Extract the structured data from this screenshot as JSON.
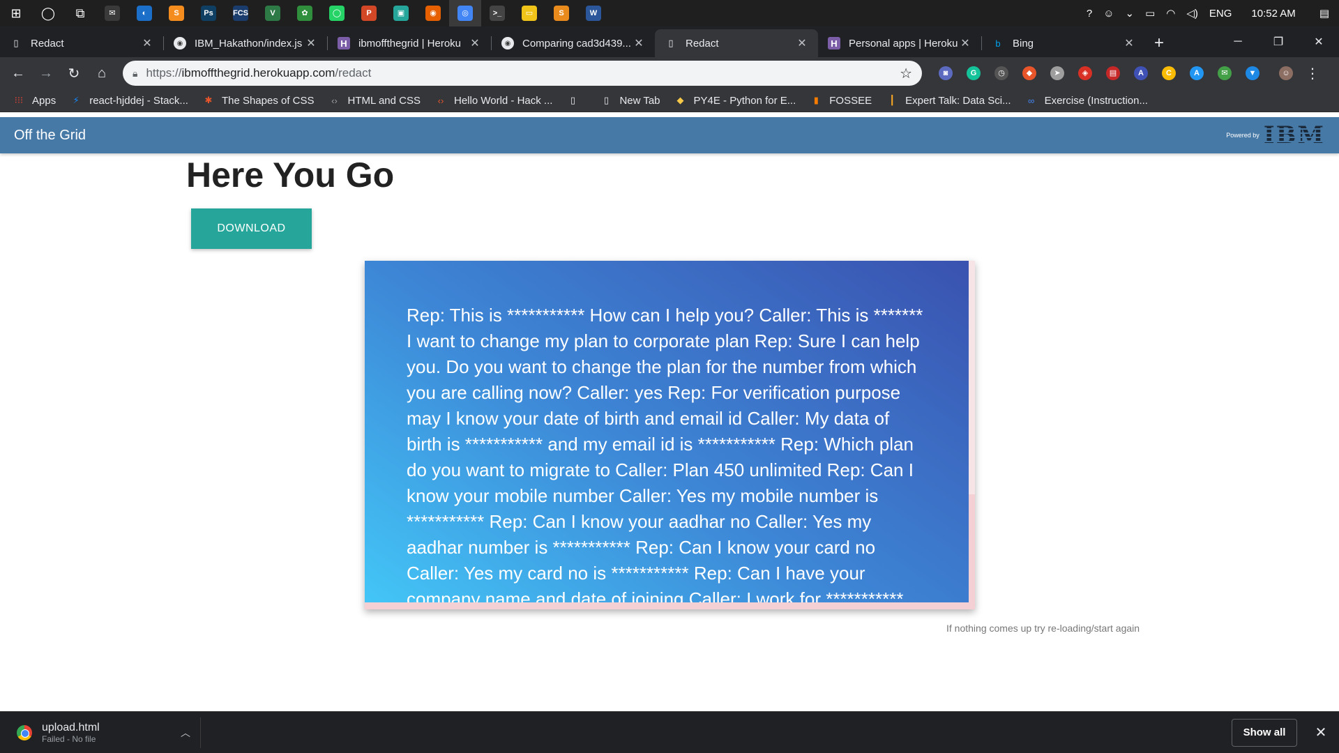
{
  "taskbar": {
    "clock": "10:52 AM",
    "language": "ENG",
    "apps": [
      {
        "name": "mail-app-icon",
        "glyph": "✉",
        "color": "#3a3a3a"
      },
      {
        "name": "steam-app-icon",
        "glyph": "◐",
        "color": "#1b6fc9"
      },
      {
        "name": "sublime-app-icon",
        "glyph": "S",
        "color": "#f58d1e"
      },
      {
        "name": "photoshop-app-icon",
        "glyph": "Ps",
        "color": "#0f3f63"
      },
      {
        "name": "fcs-app-icon",
        "glyph": "FCS",
        "color": "#1a3d6e"
      },
      {
        "name": "vue-app-icon",
        "glyph": "V",
        "color": "#2d7a46"
      },
      {
        "name": "git-app-icon",
        "glyph": "✿",
        "color": "#2f8f3c"
      },
      {
        "name": "whatsapp-app-icon",
        "glyph": "◯",
        "color": "#25d366"
      },
      {
        "name": "powerpoint-app-icon",
        "glyph": "P",
        "color": "#d24726"
      },
      {
        "name": "store-app-icon",
        "glyph": "▣",
        "color": "#26a69a"
      },
      {
        "name": "firefox-app-icon",
        "glyph": "◉",
        "color": "#e66000"
      },
      {
        "name": "chrome-app-icon",
        "glyph": "◎",
        "color": "#4285f4"
      },
      {
        "name": "terminal-app-icon",
        "glyph": ">_",
        "color": "#444444"
      },
      {
        "name": "explorer-app-icon",
        "glyph": "▭",
        "color": "#f0c419"
      },
      {
        "name": "sublime2-app-icon",
        "glyph": "S",
        "color": "#e98b1c"
      },
      {
        "name": "word-app-icon",
        "glyph": "W",
        "color": "#2b579a"
      }
    ]
  },
  "tabs": [
    {
      "label": "Redact",
      "icon": "page-icon",
      "active": false
    },
    {
      "label": "IBM_Hakathon/index.js",
      "icon": "github-icon",
      "active": false
    },
    {
      "label": "ibmoffthegrid | Heroku",
      "icon": "heroku-icon",
      "active": false
    },
    {
      "label": "Comparing cad3d439...",
      "icon": "github-icon",
      "active": false
    },
    {
      "label": "Redact",
      "icon": "page-icon",
      "active": true
    },
    {
      "label": "Personal apps | Heroku",
      "icon": "heroku-icon",
      "active": false
    },
    {
      "label": "Bing",
      "icon": "bing-icon",
      "active": false
    }
  ],
  "address": {
    "scheme": "https://",
    "host": "ibmoffthegrid.herokuapp.com",
    "path": "/redact"
  },
  "extensions": [
    {
      "name": "camera-extension-icon",
      "glyph": "◙",
      "color": "#5c6bc0"
    },
    {
      "name": "grammarly-extension-icon",
      "glyph": "G",
      "color": "#15c39a"
    },
    {
      "name": "speed-extension-icon",
      "glyph": "◷",
      "color": "#555555"
    },
    {
      "name": "shield-extension-icon",
      "glyph": "◆",
      "color": "#e8552b"
    },
    {
      "name": "compass-extension-icon",
      "glyph": "➤",
      "color": "#9e9e9e"
    },
    {
      "name": "adblock-extension-icon",
      "glyph": "◈",
      "color": "#d93025"
    },
    {
      "name": "pdf-extension-icon",
      "glyph": "▤",
      "color": "#c62828"
    },
    {
      "name": "translate-extension-icon",
      "glyph": "A",
      "color": "#3f51b5"
    },
    {
      "name": "c-extension-icon",
      "glyph": "C",
      "color": "#fbbc05"
    },
    {
      "name": "a-extension-icon",
      "glyph": "A",
      "color": "#2196f3"
    },
    {
      "name": "mail-extension-icon",
      "glyph": "✉",
      "color": "#43a047"
    },
    {
      "name": "puzzle-extension-icon",
      "glyph": "▼",
      "color": "#1e88e5"
    }
  ],
  "bookmarks": [
    {
      "label": "Apps",
      "icon": "apps-grid-icon",
      "glyph": "⁝⁝⁝",
      "color": "#ea4335"
    },
    {
      "label": "react-hjddej - Stack...",
      "icon": "lightning-icon",
      "glyph": "⚡",
      "color": "#1389fd"
    },
    {
      "label": "The Shapes of CSS",
      "icon": "css-tricks-icon",
      "glyph": "✱",
      "color": "#e8552b"
    },
    {
      "label": "HTML and CSS",
      "icon": "code-brackets-icon",
      "glyph": "‹›",
      "color": "#9aa0a6"
    },
    {
      "label": "Hello World - Hack ...",
      "icon": "hackerrank-icon",
      "glyph": "‹›",
      "color": "#e8552b"
    },
    {
      "label": "",
      "icon": "blank-page-icon",
      "glyph": "▯",
      "color": "#e8eaed"
    },
    {
      "label": "New Tab",
      "icon": "page-icon",
      "glyph": "▯",
      "color": "#e8eaed"
    },
    {
      "label": "PY4E - Python for E...",
      "icon": "python-icon",
      "glyph": "◆",
      "color": "#f7c948"
    },
    {
      "label": "FOSSEE",
      "icon": "fossee-icon",
      "glyph": "▮",
      "color": "#f57c00"
    },
    {
      "label": "Expert Talk: Data Sci...",
      "icon": "bars-icon",
      "glyph": "┃",
      "color": "#f9a825"
    },
    {
      "label": "Exercise (Instruction...",
      "icon": "infinity-icon",
      "glyph": "∞",
      "color": "#4285f4"
    }
  ],
  "app": {
    "brand": "Off the Grid",
    "powered_by": "Powered by",
    "logo_text": "IBM",
    "heading": "Here You Go",
    "download_label": "DOWNLOAD",
    "transcript": "Rep: This is *********** How can I help you? Caller: This is ******* I want to change my plan to corporate plan Rep: Sure I can help you. Do you want to change the plan for the number from which you are calling now? Caller: yes Rep: For verification purpose may I know your date of birth and email id Caller: My data of birth is *********** and my email id is *********** Rep: Which plan do you want to migrate to Caller: Plan 450 unlimited Rep: Can I know your mobile number Caller: Yes my mobile number is *********** Rep: Can I know your aadhar no Caller: Yes my aadhar number is *********** Rep: Can I know your card no Caller: Yes my card no is *********** Rep: Can I have your company name and date of joining Caller: I work for *********** and doj *********** and my employee id is ***********",
    "hint": "If nothing comes up try re-loading/start again"
  },
  "download_shelf": {
    "file_name": "upload.html",
    "status": "Failed - No file",
    "show_all": "Show all"
  }
}
